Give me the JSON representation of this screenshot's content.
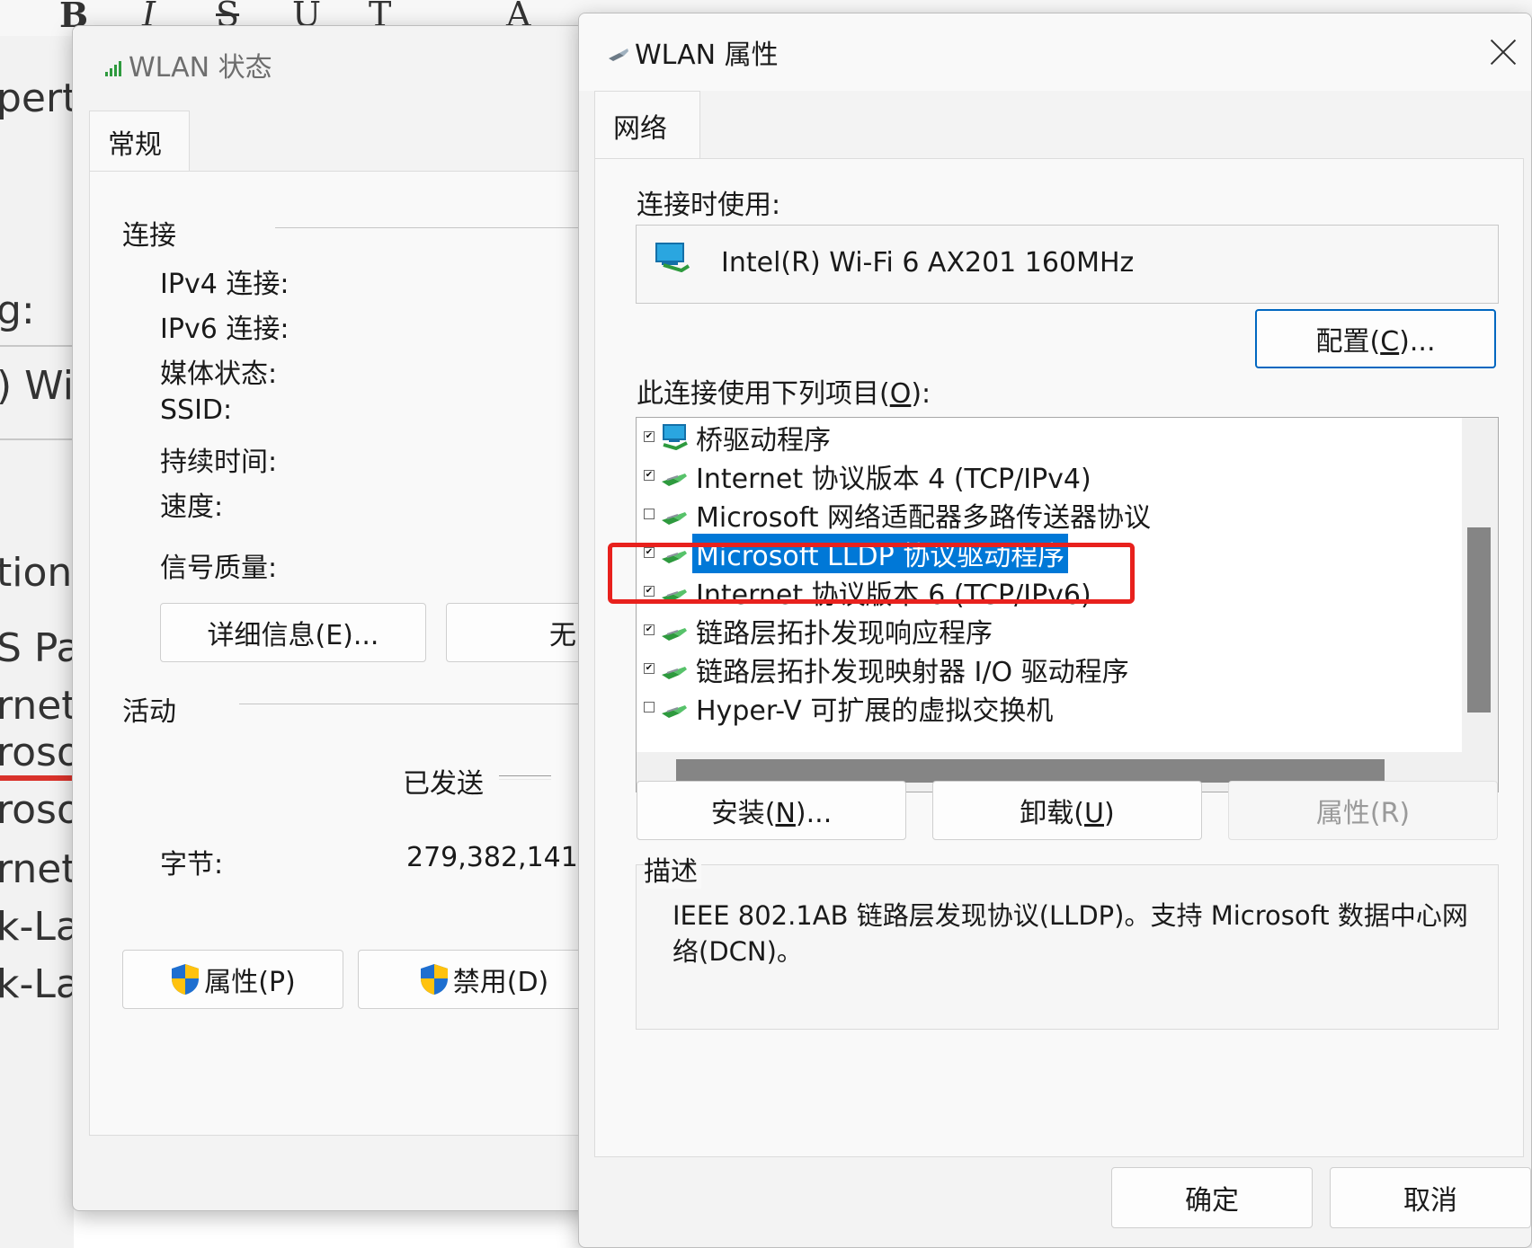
{
  "background": {
    "toolbar_glyphs": [
      "B",
      "I",
      "S",
      "U",
      "T",
      "A"
    ],
    "left_fragments": [
      "pertie",
      "g:",
      ") Wi",
      "tion u",
      "S Pa",
      "rnet",
      "rosof",
      "rosof",
      "rnet",
      "k-Lay",
      "k-Lay"
    ]
  },
  "status_dialog": {
    "title": "WLAN 状态",
    "tab": "常规",
    "connection_section": "连接",
    "fields": {
      "ipv4": "IPv4 连接:",
      "ipv6": "IPv6 连接:",
      "media": "媒体状态:",
      "ssid": "SSID:",
      "duration": "持续时间:",
      "speed": "速度:",
      "signal": "信号质量:"
    },
    "details_button": "详细信息(E)...",
    "wireless_button": "无",
    "activity_section": "活动",
    "sent_label": "已发送",
    "bytes_label": "字节:",
    "bytes_sent": "279,382,141",
    "properties_button": "属性(P)",
    "disable_button": "禁用(D)"
  },
  "props_dialog": {
    "title": "WLAN 属性",
    "tab": "网络",
    "connect_using_label": "连接时使用:",
    "adapter_name": "Intel(R) Wi-Fi 6 AX201 160MHz",
    "configure_button": {
      "pre": "配置(",
      "key": "C",
      "post": ")..."
    },
    "items_label": {
      "pre": "此连接使用下列项目(",
      "key": "O",
      "post": "):"
    },
    "items": [
      {
        "label": "桥驱动程序",
        "checked": true,
        "icon": "bridge-icon"
      },
      {
        "label": "Internet 协议版本 4 (TCP/IPv4)",
        "checked": true,
        "icon": "network-protocol-icon"
      },
      {
        "label": "Microsoft 网络适配器多路传送器协议",
        "checked": false,
        "icon": "network-protocol-icon"
      },
      {
        "label": "Microsoft LLDP 协议驱动程序",
        "checked": true,
        "icon": "network-protocol-icon",
        "selected": true
      },
      {
        "label": "Internet 协议版本 6 (TCP/IPv6)",
        "checked": true,
        "icon": "network-protocol-icon"
      },
      {
        "label": "链路层拓扑发现响应程序",
        "checked": true,
        "icon": "network-protocol-icon"
      },
      {
        "label": "链路层拓扑发现映射器 I/O 驱动程序",
        "checked": true,
        "icon": "network-protocol-icon"
      },
      {
        "label": "Hyper-V 可扩展的虚拟交换机",
        "checked": false,
        "icon": "network-protocol-icon"
      }
    ],
    "install_button": {
      "pre": "安装(",
      "key": "N",
      "post": ")..."
    },
    "uninstall_button": {
      "pre": "卸载(",
      "key": "U",
      "post": ")"
    },
    "properties_button": "属性(R)",
    "description_label": "描述",
    "description_text": "IEEE 802.1AB 链路层发现协议(LLDP)。支持 Microsoft 数据中心网络(DCN)。",
    "ok_button": "确定",
    "cancel_button": "取消"
  },
  "colors": {
    "selection": "#0078d7",
    "highlight_box": "#e8211d",
    "primary_border": "#0067c0",
    "shield_blue": "#1e6fd0",
    "shield_yellow": "#ffc20e"
  }
}
